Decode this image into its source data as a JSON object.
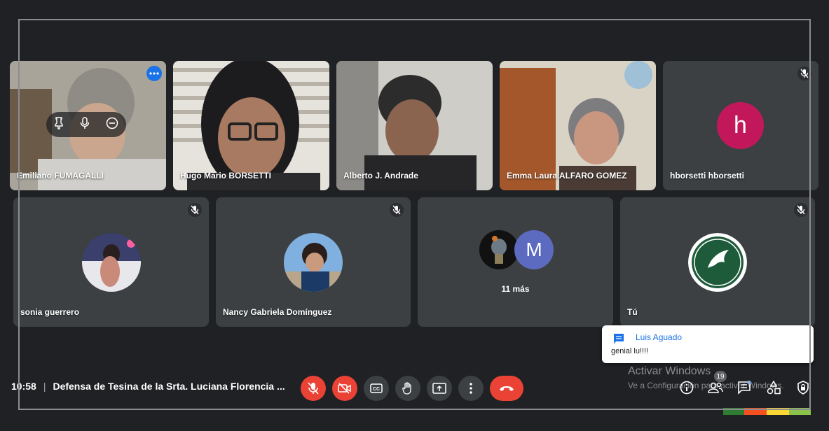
{
  "tiles_row1": [
    {
      "name": "Emiliano FUMAGALLI"
    },
    {
      "name": "Hugo Mario BORSETTI"
    },
    {
      "name": "Alberto J. Andrade"
    },
    {
      "name": "Emma Laura ALFARO GOMEZ"
    },
    {
      "name": "hborsetti hborsetti",
      "avatar_letter": "h",
      "avatar_color": "#c2185b"
    }
  ],
  "tiles_row2": [
    {
      "name": "sonia guerrero"
    },
    {
      "name": "Nancy Gabriela Domínguez"
    },
    {
      "others_label": "11 más",
      "avatar_letter": "M",
      "avatar_color": "#5c6bc0"
    },
    {
      "name": "Tú"
    }
  ],
  "meeting": {
    "time": "10:58",
    "separator": "|",
    "title": "Defensa de Tesina de la Srta. Luciana Florencia ..."
  },
  "chat_toast": {
    "sender": "Luis Aguado",
    "message": "genial lu!!!!"
  },
  "activate_windows": {
    "title": "Activar Windows",
    "subtitle": "Ve a Configuración para activar Windows."
  },
  "people_count": "19",
  "colors": {
    "accent": "#1a73e8",
    "danger": "#ea4335",
    "surface": "#3c4043",
    "background": "#202124"
  },
  "icons": [
    "pin-icon",
    "mic-icon",
    "remove-icon",
    "more-options-icon",
    "mic-off-icon",
    "camera-off-icon",
    "captions-icon",
    "raise-hand-icon",
    "present-icon",
    "more-vert-icon",
    "hangup-icon",
    "info-icon",
    "people-icon",
    "chat-icon",
    "activities-icon",
    "lock-icon",
    "chat-bubble-icon"
  ]
}
